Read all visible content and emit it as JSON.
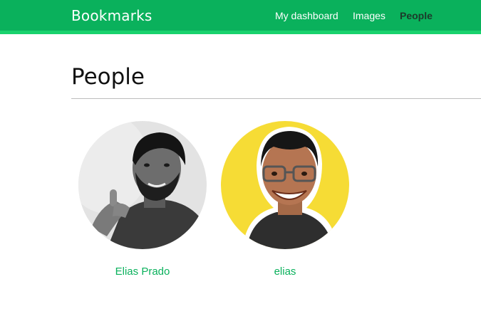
{
  "header": {
    "brand": "Bookmarks",
    "menu": [
      {
        "label": "My dashboard",
        "active": false
      },
      {
        "label": "Images",
        "active": false
      },
      {
        "label": "People",
        "active": true
      }
    ]
  },
  "main": {
    "title": "People",
    "people": [
      {
        "name": "Elias Prado",
        "photo": "grayscale portrait, man with beard giving thumbs up"
      },
      {
        "name": "elias",
        "photo": "smiling man with glasses on yellow background"
      }
    ]
  },
  "colors": {
    "brand_green": "#0ab15c",
    "brand_green_light": "#19d26d",
    "active_menu_text": "#1c3a2a",
    "link_green": "#0ab15c"
  }
}
